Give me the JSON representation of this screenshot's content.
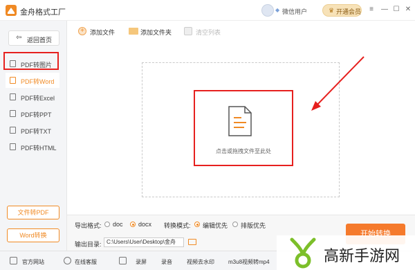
{
  "app": {
    "title": "金舟格式工厂"
  },
  "header": {
    "user_name": "微信用户",
    "vip_label": "开通会员",
    "vip_icon": "crown-icon"
  },
  "window_controls": [
    "menu",
    "minimize",
    "maximize",
    "close"
  ],
  "sidebar": {
    "home_label": "返回首页",
    "items": [
      {
        "label": "PDF转图片",
        "active": false
      },
      {
        "label": "PDF转Word",
        "active": true
      },
      {
        "label": "PDF转Excel",
        "active": false
      },
      {
        "label": "PDF转PPT",
        "active": false
      },
      {
        "label": "PDF转TXT",
        "active": false
      },
      {
        "label": "PDF转HTML",
        "active": false
      }
    ],
    "file_to_pdf": "文件转PDF",
    "word_convert": "Word转换"
  },
  "toolbar": {
    "add_file": "添加文件",
    "add_folder": "添加文件夹",
    "clear_list": "清空列表"
  },
  "dropzone": {
    "hint": "点击或拖拽文件至此处"
  },
  "settings": {
    "export_format_label": "导出格式:",
    "formats": [
      {
        "label": "doc",
        "selected": false
      },
      {
        "label": "docx",
        "selected": true
      }
    ],
    "mode_label": "转换模式:",
    "modes": [
      {
        "label": "编辑优先",
        "selected": true
      },
      {
        "label": "排版优先",
        "selected": false
      }
    ],
    "output_label": "输出目录:",
    "output_path": "C:\\Users\\User\\Desktop\\金舟",
    "path_more": "•••"
  },
  "start_button": "开始转换",
  "footer": {
    "items": [
      {
        "label": "官方网站"
      },
      {
        "label": "在线客服"
      },
      {
        "label": "录屏"
      },
      {
        "label": "录音"
      },
      {
        "label": "视频去水印"
      },
      {
        "label": "m3u8视频转mp4"
      }
    ]
  },
  "watermark": {
    "text": "高新手游网"
  },
  "colors": {
    "accent": "#f08a24",
    "highlight": "#e6201e",
    "start_btn": "#f57a2c"
  }
}
